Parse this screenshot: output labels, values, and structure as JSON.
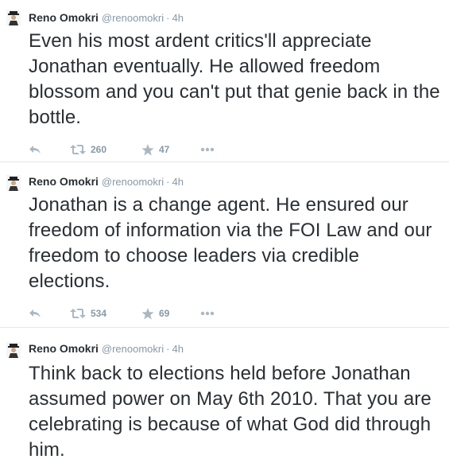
{
  "tweets": [
    {
      "name": "Reno Omokri",
      "handle": "@renoomokri",
      "time": "4h",
      "text": "Even his most ardent critics'll appreciate Jonathan eventually. He allowed freedom blossom and you can't put that genie back in the bottle.",
      "retweets": "260",
      "favorites": "47"
    },
    {
      "name": "Reno Omokri",
      "handle": "@renoomokri",
      "time": "4h",
      "text": "Jonathan is a change agent. He ensured our freedom of information via the FOI Law and our freedom to choose leaders via credible elections.",
      "retweets": "534",
      "favorites": "69"
    },
    {
      "name": "Reno Omokri",
      "handle": "@renoomokri",
      "time": "4h",
      "text": "Think back to elections held before Jonathan assumed power on May 6th 2010. That you are celebrating is because of what God did through him."
    }
  ],
  "separator": "·",
  "icons": {
    "avatar": "avatar-icon",
    "reply": "reply-icon",
    "retweet": "retweet-icon",
    "favorite": "star-icon",
    "more": "more-icon"
  },
  "colors": {
    "text": "#292f33",
    "muted": "#8899a6",
    "icon": "#aab8c2",
    "divider": "#e1e8ed"
  }
}
